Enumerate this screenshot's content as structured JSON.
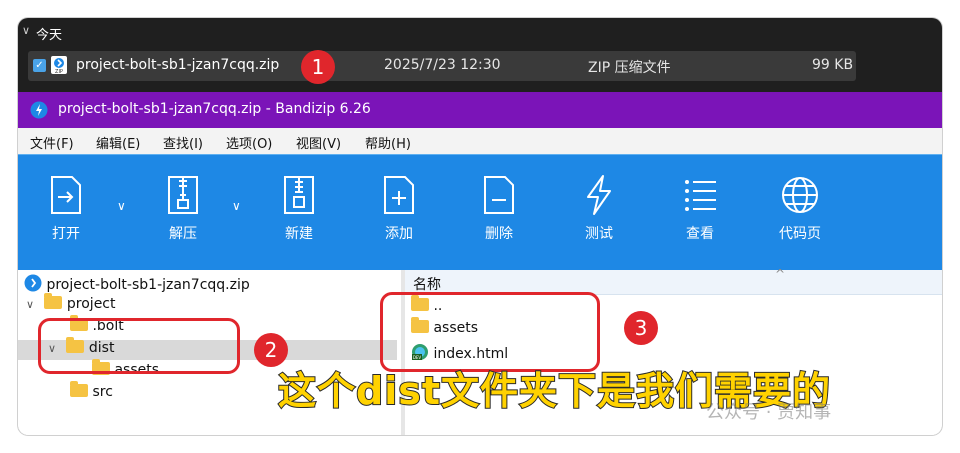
{
  "explorer": {
    "group_label": "今天",
    "file": {
      "name": "project-bolt-sb1-jzan7cqq.zip",
      "modified": "2025/7/23 12:30",
      "type": "ZIP 压缩文件",
      "size": "99 KB"
    }
  },
  "bandizip": {
    "title": "project-bolt-sb1-jzan7cqq.zip - Bandizip 6.26",
    "menu": [
      "文件(F)",
      "编辑(E)",
      "查找(I)",
      "选项(O)",
      "视图(V)",
      "帮助(H)"
    ],
    "toolbar": {
      "open": "打开",
      "extract": "解压",
      "new": "新建",
      "add": "添加",
      "delete": "删除",
      "test": "测试",
      "view": "查看",
      "codepage": "代码页"
    },
    "tree": {
      "root": "project-bolt-sb1-jzan7cqq.zip",
      "project": "project",
      "bolt": ".bolt",
      "dist": "dist",
      "assets": "assets",
      "src": "src"
    },
    "list": {
      "column_name": "名称",
      "items": [
        "..",
        "assets",
        "index.html"
      ]
    }
  },
  "annotations": {
    "marker1": "1",
    "marker2": "2",
    "marker3": "3",
    "caption": "这个dist文件夹下是我们需要的",
    "watermark": "公众号 · 贾知事"
  },
  "colors": {
    "title_purple": "#7b14b8",
    "toolbar_blue": "#1e88e5",
    "annotation_red": "#e0262c",
    "caption_yellow": "#ffd200",
    "folder_yellow": "#f5c343"
  },
  "icons": [
    "check-icon",
    "zip-file-icon",
    "bandizip-app-icon",
    "open-icon",
    "extract-icon",
    "new-archive-icon",
    "add-icon",
    "delete-icon",
    "test-icon",
    "view-list-icon",
    "globe-icon",
    "folder-icon",
    "chevron-down-icon",
    "html-file-icon",
    "sort-up-icon"
  ]
}
